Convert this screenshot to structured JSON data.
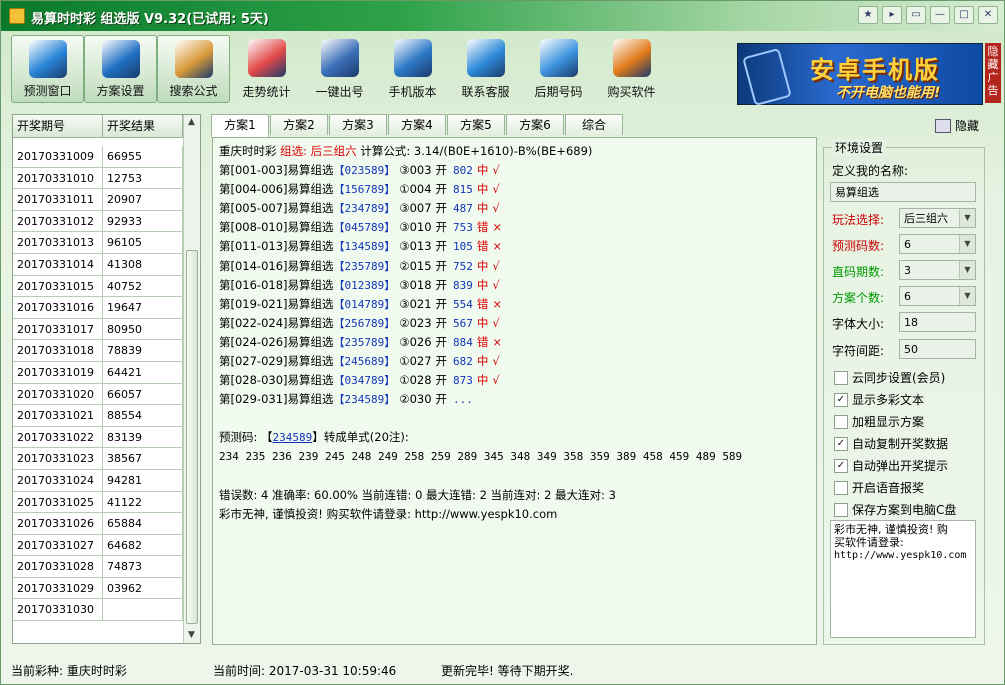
{
  "window": {
    "title": "易算时时彩 组选版 V9.32(已试用: 5天)",
    "buttons": [
      "★",
      "▸",
      "▭",
      "—",
      "□",
      "✕"
    ]
  },
  "toolbar": [
    {
      "label": "预测窗口",
      "icon": "cloud-icon",
      "color": "#2a86d8",
      "active": true
    },
    {
      "label": "方案设置",
      "icon": "monitor-icon",
      "color": "#2170c4",
      "active": true
    },
    {
      "label": "搜索公式",
      "icon": "calculator-icon",
      "color": "#d99a3a",
      "active": true
    },
    {
      "label": "走势统计",
      "icon": "trend-chart-icon",
      "color": "#e24a4a",
      "active": false
    },
    {
      "label": "一键出号",
      "icon": "gear-screen-icon",
      "color": "#3b6fb8",
      "active": false
    },
    {
      "label": "手机版本",
      "icon": "mobile-icon",
      "color": "#2e79c7",
      "active": false
    },
    {
      "label": "联系客服",
      "icon": "user-support-icon",
      "color": "#2e8ad8",
      "active": false
    },
    {
      "label": "后期号码",
      "icon": "folder-icon",
      "color": "#3f95df",
      "active": false
    },
    {
      "label": "购买软件",
      "icon": "key-icon",
      "color": "#e07a1a",
      "active": false
    }
  ],
  "ad": {
    "title": "安卓手机版",
    "subtitle": "不开电脑也能用!",
    "side": "隐藏广告"
  },
  "left_table": {
    "headers": [
      "开奖期号",
      "开奖结果"
    ],
    "rows": [
      [
        "20170331009",
        "66955"
      ],
      [
        "20170331010",
        "12753"
      ],
      [
        "20170331011",
        "20907"
      ],
      [
        "20170331012",
        "92933"
      ],
      [
        "20170331013",
        "96105"
      ],
      [
        "20170331014",
        "41308"
      ],
      [
        "20170331015",
        "40752"
      ],
      [
        "20170331016",
        "19647"
      ],
      [
        "20170331017",
        "80950"
      ],
      [
        "20170331018",
        "78839"
      ],
      [
        "20170331019",
        "64421"
      ],
      [
        "20170331020",
        "66057"
      ],
      [
        "20170331021",
        "88554"
      ],
      [
        "20170331022",
        "83139"
      ],
      [
        "20170331023",
        "38567"
      ],
      [
        "20170331024",
        "94281"
      ],
      [
        "20170331025",
        "41122"
      ],
      [
        "20170331026",
        "65884"
      ],
      [
        "20170331027",
        "64682"
      ],
      [
        "20170331028",
        "74873"
      ],
      [
        "20170331029",
        "03962"
      ],
      [
        "20170331030",
        ""
      ]
    ]
  },
  "tabs": [
    "方案1",
    "方案2",
    "方案3",
    "方案4",
    "方案5",
    "方案6",
    "综合"
  ],
  "hide_label": "隐藏",
  "main": {
    "header": {
      "prefix": "重庆时时彩 ",
      "red": "组选: 后三组六",
      "suffix": " 计算公式: 3.14/(B0E+1610)-B%(BE+689)"
    },
    "records": [
      {
        "range": "第[001-003]",
        "name": "易算组选",
        "code": "【023589】",
        "idx": "③003",
        "open": "开",
        "num": "802",
        "res": "中",
        "mark": "√"
      },
      {
        "range": "第[004-006]",
        "name": "易算组选",
        "code": "【156789】",
        "idx": "①004",
        "open": "开",
        "num": "815",
        "res": "中",
        "mark": "√"
      },
      {
        "range": "第[005-007]",
        "name": "易算组选",
        "code": "【234789】",
        "idx": "③007",
        "open": "开",
        "num": "487",
        "res": "中",
        "mark": "√"
      },
      {
        "range": "第[008-010]",
        "name": "易算组选",
        "code": "【045789】",
        "idx": "③010",
        "open": "开",
        "num": "753",
        "res": "错",
        "mark": "×"
      },
      {
        "range": "第[011-013]",
        "name": "易算组选",
        "code": "【134589】",
        "idx": "③013",
        "open": "开",
        "num": "105",
        "res": "错",
        "mark": "×"
      },
      {
        "range": "第[014-016]",
        "name": "易算组选",
        "code": "【235789】",
        "idx": "②015",
        "open": "开",
        "num": "752",
        "res": "中",
        "mark": "√"
      },
      {
        "range": "第[016-018]",
        "name": "易算组选",
        "code": "【012389】",
        "idx": "③018",
        "open": "开",
        "num": "839",
        "res": "中",
        "mark": "√"
      },
      {
        "range": "第[019-021]",
        "name": "易算组选",
        "code": "【014789】",
        "idx": "③021",
        "open": "开",
        "num": "554",
        "res": "错",
        "mark": "×"
      },
      {
        "range": "第[022-024]",
        "name": "易算组选",
        "code": "【256789】",
        "idx": "②023",
        "open": "开",
        "num": "567",
        "res": "中",
        "mark": "√"
      },
      {
        "range": "第[024-026]",
        "name": "易算组选",
        "code": "【235789】",
        "idx": "③026",
        "open": "开",
        "num": "884",
        "res": "错",
        "mark": "×"
      },
      {
        "range": "第[027-029]",
        "name": "易算组选",
        "code": "【245689】",
        "idx": "①027",
        "open": "开",
        "num": "682",
        "res": "中",
        "mark": "√"
      },
      {
        "range": "第[028-030]",
        "name": "易算组选",
        "code": "【034789】",
        "idx": "①028",
        "open": "开",
        "num": "873",
        "res": "中",
        "mark": "√"
      },
      {
        "range": "第[029-031]",
        "name": "易算组选",
        "code": "【234589】",
        "idx": "②030",
        "open": "开",
        "num": "...",
        "res": "",
        "mark": ""
      }
    ],
    "predict_label": "预测码: 【",
    "predict_code": "234589",
    "predict_suffix": "】转成单式(20注):",
    "singles": "234 235 236 239 245 248 249 258 259 289 345 348 349 358 359 389 458 459 489 589",
    "stats": "错误数: 4 准确率: 60.00% 当前连错: 0 最大连错: 2 当前连对: 2 最大连对: 3",
    "notice": "彩市无神, 谨慎投资! 购买软件请登录: http://www.yespk10.com"
  },
  "settings": {
    "legend": "环境设置",
    "name_label": "定义我的名称:",
    "name_value": "易算组选",
    "play_label": "玩法选择:",
    "play_value": "后三组六",
    "count_label": "预测码数:",
    "count_value": "6",
    "period_label": "直码期数:",
    "period_value": "3",
    "plan_label": "方案个数:",
    "plan_value": "6",
    "font_label": "字体大小:",
    "font_value": "18",
    "spacing_label": "字符间距:",
    "spacing_value": "50",
    "checks": [
      {
        "label": "云同步设置(会员)",
        "checked": false
      },
      {
        "label": "显示多彩文本",
        "checked": true
      },
      {
        "label": "加粗显示方案",
        "checked": false
      },
      {
        "label": "自动复制开奖数据",
        "checked": true
      },
      {
        "label": "自动弹出开奖提示",
        "checked": true
      },
      {
        "label": "开启语音报奖",
        "checked": false
      },
      {
        "label": "保存方案到电脑C盘",
        "checked": false
      }
    ],
    "note_line1": "彩市无神, 谨慎投资! 购",
    "note_line2": "买软件请登录:",
    "note_line3": "http://www.yespk10.com"
  },
  "status": {
    "lottery": "当前彩种: 重庆时时彩",
    "time": "当前时间: 2017-03-31 10:59:46",
    "msg": "更新完毕! 等待下期开奖."
  }
}
